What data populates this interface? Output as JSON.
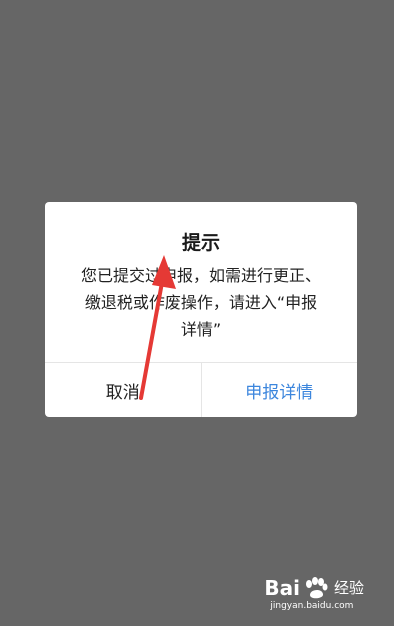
{
  "dialog": {
    "title": "提示",
    "message_lines": [
      "您已提交过申报，如需进行更正、",
      "缴退税或作废操作，请进入“申报",
      "详情”"
    ],
    "cancel_label": "取消",
    "confirm_label": "申报详情"
  },
  "watermark": {
    "brand_left": "Bai",
    "brand_right": "经验",
    "url": "jingyan.baidu.com"
  },
  "colors": {
    "overlay": "#666666",
    "confirm_text": "#3c86dd",
    "annotation_arrow": "#e53935"
  }
}
